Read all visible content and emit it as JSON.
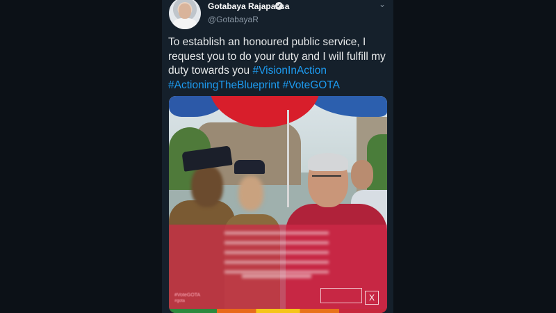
{
  "author": {
    "name": "Gotabaya Rajapaksa",
    "handle": "@GotabayaR"
  },
  "tweet": {
    "text": "To establish an honoured public service, I request you to do your duty and I will fulfill my duty towards you ",
    "hashtags": [
      "#VisionInAction",
      "#ActioningTheBlueprint",
      "#VoteGOTA"
    ]
  },
  "media": {
    "close_label": "X",
    "tag_line1": "#VoteGOTA",
    "tag_line2": "#gota"
  },
  "icons": {
    "verified": "verified-badge-icon",
    "menu": "chevron-down-icon"
  },
  "colors": {
    "background": "#15202b",
    "hashtag": "#1d9bf0"
  }
}
